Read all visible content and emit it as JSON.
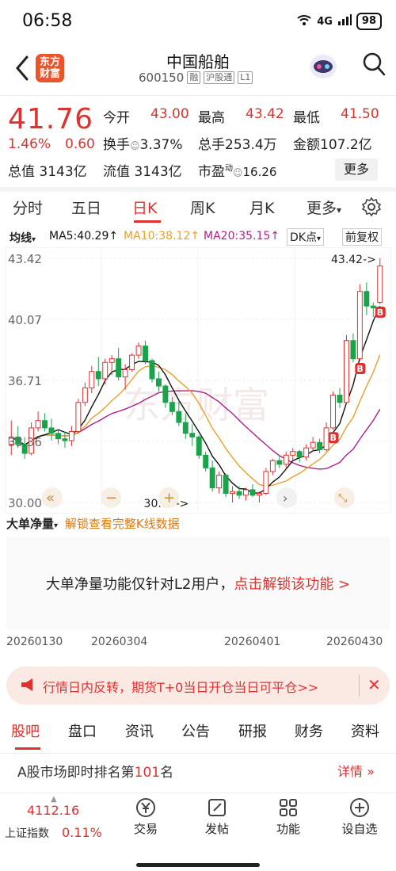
{
  "status": {
    "time": "06:58",
    "signal": "4G",
    "battery": "98"
  },
  "header": {
    "logo_line1": "东方",
    "logo_line2": "财富",
    "title": "中国船舶",
    "code": "600150",
    "tags": [
      "融",
      "沪股通",
      "L1"
    ]
  },
  "quote": {
    "price": "41.76",
    "pct": "1.46%",
    "chg": "0.60",
    "open_label": "今开",
    "open": "43.00",
    "high_label": "最高",
    "high": "43.42",
    "low_label": "最低",
    "low": "41.50",
    "turnover_label": "换手",
    "turnover": "3.37%",
    "vol_label": "总手",
    "vol": "253.4万",
    "amt_label": "金额",
    "amt": "107.2亿",
    "mktcap_label": "总值",
    "mktcap": "3143亿",
    "float_label": "流值",
    "float": "3143亿",
    "pe_label": "市盈",
    "pe_sup": "动",
    "pe": "16.26",
    "more": "更多"
  },
  "tabs": [
    "分时",
    "五日",
    "日K",
    "周K",
    "月K",
    "更多"
  ],
  "indicators": {
    "main": "均线",
    "ma5": "MA5:40.29↑",
    "ma10": "MA10:38.12↑",
    "ma20": "MA20:35.15↑",
    "dk": "DK点",
    "adj": "前复权"
  },
  "chart_data": {
    "type": "candlestick",
    "y_ticks": [
      "43.42",
      "40.07",
      "36.71",
      "33.36",
      "30.00"
    ],
    "ylim": [
      30.0,
      43.42
    ],
    "high_marker": "43.42->",
    "low_marker": "30.00->",
    "x_ticks": [
      "20260130",
      "20260304",
      "20260401",
      "20260430"
    ],
    "candles": [
      [
        33.2,
        34.5,
        32.6,
        33.6
      ],
      [
        33.6,
        34.2,
        33.0,
        33.2
      ],
      [
        33.2,
        33.6,
        32.4,
        32.7
      ],
      [
        32.7,
        34.4,
        32.6,
        34.1
      ],
      [
        34.1,
        35.0,
        33.9,
        34.5
      ],
      [
        34.5,
        34.9,
        33.9,
        34.1
      ],
      [
        34.1,
        34.6,
        33.4,
        33.8
      ],
      [
        33.8,
        34.0,
        33.2,
        33.5
      ],
      [
        33.5,
        33.9,
        33.0,
        33.4
      ],
      [
        33.4,
        34.2,
        33.1,
        33.9
      ],
      [
        33.9,
        35.7,
        33.8,
        35.5
      ],
      [
        35.5,
        36.6,
        35.3,
        36.3
      ],
      [
        36.3,
        37.5,
        36.0,
        37.2
      ],
      [
        37.2,
        38.0,
        36.4,
        36.8
      ],
      [
        36.8,
        37.9,
        36.5,
        37.7
      ],
      [
        37.7,
        38.1,
        37.0,
        37.9
      ],
      [
        37.9,
        38.5,
        36.7,
        36.9
      ],
      [
        36.9,
        37.6,
        36.2,
        37.3
      ],
      [
        37.3,
        38.2,
        37.2,
        38.1
      ],
      [
        38.1,
        38.8,
        37.9,
        38.6
      ],
      [
        38.6,
        38.9,
        37.6,
        37.8
      ],
      [
        37.8,
        37.9,
        36.6,
        36.8
      ],
      [
        36.8,
        37.2,
        36.1,
        36.4
      ],
      [
        36.4,
        36.5,
        35.2,
        35.5
      ],
      [
        35.5,
        35.8,
        34.8,
        35.0
      ],
      [
        35.0,
        35.6,
        34.2,
        34.4
      ],
      [
        34.4,
        34.9,
        33.5,
        33.8
      ],
      [
        33.8,
        34.3,
        33.1,
        33.6
      ],
      [
        33.6,
        33.7,
        32.4,
        32.6
      ],
      [
        32.6,
        32.8,
        31.7,
        31.9
      ],
      [
        31.9,
        32.3,
        30.6,
        30.8
      ],
      [
        30.8,
        31.7,
        30.5,
        31.5
      ],
      [
        31.5,
        31.6,
        30.3,
        30.5
      ],
      [
        30.5,
        30.9,
        30.0,
        30.6
      ],
      [
        30.6,
        30.9,
        30.2,
        30.4
      ],
      [
        30.4,
        30.8,
        30.1,
        30.7
      ],
      [
        30.7,
        31.0,
        30.3,
        30.4
      ],
      [
        30.4,
        30.6,
        30.0,
        30.5
      ],
      [
        30.5,
        31.9,
        30.4,
        31.7
      ],
      [
        31.7,
        32.4,
        31.5,
        32.3
      ],
      [
        32.3,
        32.6,
        31.9,
        32.1
      ],
      [
        32.1,
        32.8,
        31.8,
        32.6
      ],
      [
        32.6,
        33.0,
        32.3,
        32.8
      ],
      [
        32.8,
        32.9,
        32.2,
        32.5
      ],
      [
        32.5,
        33.2,
        32.3,
        33.0
      ],
      [
        33.0,
        33.6,
        32.8,
        33.3
      ],
      [
        33.3,
        33.5,
        32.7,
        32.9
      ],
      [
        32.9,
        34.4,
        32.8,
        34.1
      ],
      [
        34.1,
        36.1,
        34.0,
        35.9
      ],
      [
        35.9,
        36.3,
        35.2,
        35.5
      ],
      [
        35.5,
        39.2,
        35.4,
        38.9
      ],
      [
        38.9,
        39.3,
        37.7,
        37.9
      ],
      [
        37.9,
        42.0,
        37.8,
        41.6
      ],
      [
        41.6,
        42.1,
        40.3,
        40.8
      ],
      [
        40.8,
        41.0,
        40.2,
        40.7
      ],
      [
        41.0,
        43.42,
        40.9,
        43.0
      ]
    ]
  },
  "unlock": {
    "label": "大单净量",
    "link": "解锁查看完整K线数据"
  },
  "l2": {
    "text": "大单净量功能仅针对L2用户，",
    "link": "点击解锁该功能 >"
  },
  "banner": {
    "text": "行情日内反转，期货T+0当日开仓当日可平仓>>"
  },
  "bottom_tabs": [
    "股吧",
    "盘口",
    "资讯",
    "公告",
    "研报",
    "财务",
    "资料"
  ],
  "rank": {
    "prefix": "A股市场即时排名第",
    "num": "101",
    "suffix": "名",
    "details": "详情"
  },
  "index": {
    "value": "4112.16",
    "name": "上证指数",
    "pct": "0.11%"
  },
  "nav": [
    {
      "label": "交易",
      "icon": "yen-icon"
    },
    {
      "label": "发帖",
      "icon": "edit-icon"
    },
    {
      "label": "功能",
      "icon": "grid-icon"
    },
    {
      "label": "设自选",
      "icon": "add-circle-icon"
    }
  ],
  "colors": {
    "up": "#e03131",
    "down": "#1aa34a",
    "ma5": "#111111",
    "ma10": "#e8a12c",
    "ma20": "#b0208a"
  }
}
